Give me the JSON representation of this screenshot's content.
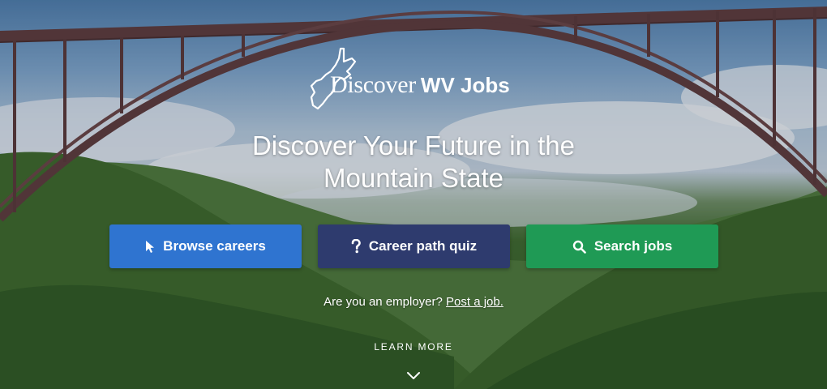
{
  "brand": {
    "logo_word": "Discover",
    "logo_strong": "WV Jobs"
  },
  "hero": {
    "headline_line1": "Discover Your Future in the",
    "headline_line2": "Mountain State"
  },
  "actions": {
    "browse_label": "Browse careers",
    "browse_icon": "cursor-icon",
    "quiz_label": "Career path quiz",
    "quiz_icon": "question-mark-icon",
    "search_label": "Search jobs",
    "search_icon": "search-icon"
  },
  "employer": {
    "prompt": "Are you an employer?",
    "link": "Post a job."
  },
  "learn_more": {
    "label": "LEARN MORE",
    "icon": "chevron-down-icon"
  },
  "colors": {
    "browse": "#2f74d0",
    "quiz": "#2e3b6e",
    "search": "#1f9a55",
    "text": "#ffffff"
  }
}
